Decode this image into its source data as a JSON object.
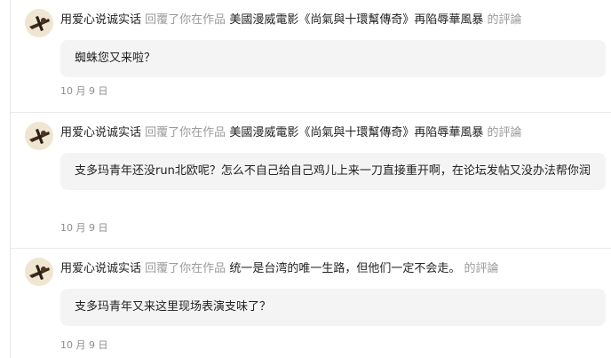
{
  "comments": [
    {
      "user": "用爱心说诚实话",
      "action": "回覆了你在作品",
      "work_title": "美國漫威電影《尚氣與十環幫傳奇》再陷辱華風暴",
      "suffix": "的評論",
      "content": "蜘蛛您又来啦？",
      "date": "10 月 9 日"
    },
    {
      "user": "用爱心说诚实话",
      "action": "回覆了你在作品",
      "work_title": "美國漫威電影《尚氣與十環幫傳奇》再陷辱華風暴",
      "suffix": "的評論",
      "content": "支多玛青年还没run北欧呢？怎么不自己给自己鸡儿上来一刀直接重开啊，在论坛发帖又没办法帮你润",
      "date": "10 月 9 日"
    },
    {
      "user": "用爱心说诚实话",
      "action": "回覆了你在作品",
      "work_title": "统一是台湾的唯一生路，但他们一定不会走。",
      "suffix": "的評論",
      "content": "支多玛青年又来这里现场表演支味了？",
      "date": "10 月 9 日"
    }
  ],
  "colors": {
    "muted": "#9a9a9a",
    "bubble_bg": "#f4f4f4"
  },
  "icons": {
    "avatar": "user-avatar-icon"
  }
}
